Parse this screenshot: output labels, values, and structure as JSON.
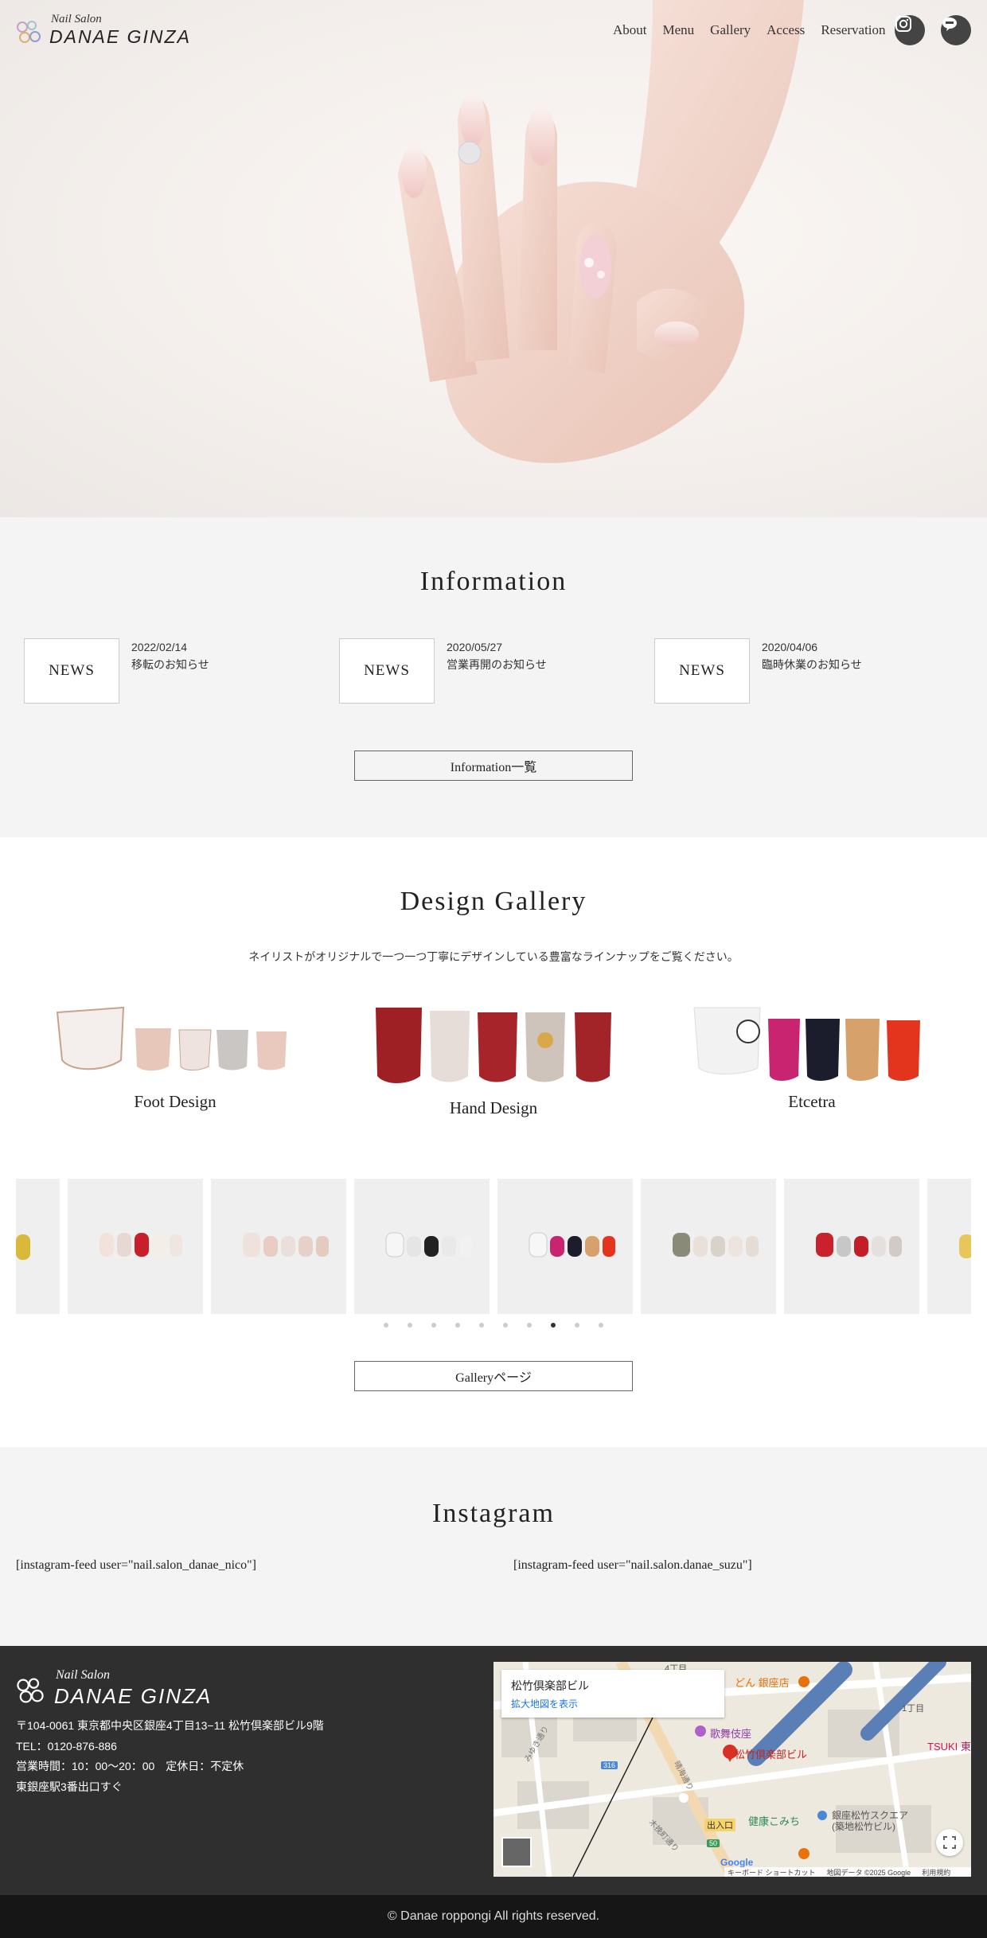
{
  "header": {
    "logo_small": "Nail Salon",
    "logo_big": "DANAE GINZA",
    "nav": [
      "About",
      "Menu",
      "Gallery",
      "Access",
      "Reservation"
    ],
    "icons": [
      "instagram-icon",
      "line-icon"
    ]
  },
  "information": {
    "title": "Information",
    "items": [
      {
        "badge": "NEWS",
        "date": "2022/02/14",
        "title": "移転のお知らせ"
      },
      {
        "badge": "NEWS",
        "date": "2020/05/27",
        "title": "営業再開のお知らせ"
      },
      {
        "badge": "NEWS",
        "date": "2020/04/06",
        "title": "臨時休業のお知らせ"
      }
    ],
    "more_button": "Information一覧"
  },
  "gallery": {
    "title": "Design Gallery",
    "description": "ネイリストがオリジナルで一つ一つ丁寧にデザインしている豊富なラインナップをご覧ください。",
    "categories": [
      "Foot Design",
      "Hand Design",
      "Etcetra"
    ],
    "slider_dot_count": 10,
    "slider_active_dot": 8,
    "more_button": "Galleryページ"
  },
  "instagram": {
    "title": "Instagram",
    "feeds": [
      "[instagram-feed user=\"nail.salon_danae_nico\"]",
      "[instagram-feed user=\"nail.salon.danae_suzu\"]"
    ]
  },
  "footer": {
    "logo_small": "Nail Salon",
    "logo_big": "DANAE GINZA",
    "address": "〒104-0061 東京都中央区銀座4丁目13−11 松竹倶楽部ビル9階",
    "tel": "TEL：0120-876-886",
    "hours": "営業時間：10：00〜20：00　定休日：不定休",
    "access": "東銀座駅3番出口すぐ",
    "map": {
      "place_name": "松竹倶楽部ビル",
      "enlarge_link": "拡大地図を表示",
      "labels": [
        "歌舞伎座",
        "松竹倶楽部ビル",
        "銀座松竹スクエア",
        "(築地松竹ビル)",
        "健康こみち",
        "出入口",
        "1丁目",
        "4丁目",
        "TSUKI 東",
        "みゆき通り",
        "晴海通り",
        "木挽町通り",
        "どん 銀座店"
      ],
      "route_badges": [
        "316",
        "50"
      ],
      "footer_texts": [
        "キーボード ショートカット",
        "地図データ ©2025 Google",
        "利用規約"
      ],
      "brand": "Google"
    }
  },
  "copyright": "© Danae roppongi All rights reserved."
}
